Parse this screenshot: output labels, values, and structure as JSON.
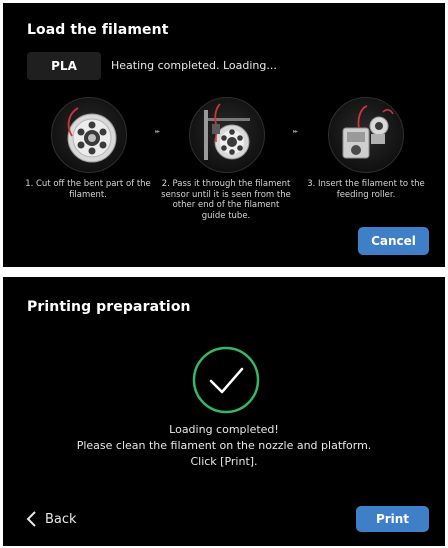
{
  "load_panel": {
    "title": "Load the filament",
    "material": "PLA",
    "status": "Heating completed. Loading...",
    "arrow_glyph": "▸▸",
    "steps": [
      {
        "caption": "1. Cut off the bent part  of the filament.",
        "icon": "filament-spool-icon"
      },
      {
        "caption": "2. Pass it through the filament sensor until it is seen from the other end of the filament guide tube.",
        "icon": "filament-sensor-icon"
      },
      {
        "caption": "3. Insert the filament to the feeding roller.",
        "icon": "extruder-feeder-icon"
      }
    ],
    "cancel_label": "Cancel"
  },
  "prep_panel": {
    "title": "Printing preparation",
    "message_lines": [
      "Loading completed!",
      "Please clean the filament on the nozzle and platform.",
      "Click [Print]."
    ],
    "back_label": "Back",
    "print_label": "Print"
  },
  "colors": {
    "panel_bg": "#000000",
    "accent_blue": "#3f7fc8",
    "success_green": "#35b865",
    "filament_red": "#d0343c"
  }
}
